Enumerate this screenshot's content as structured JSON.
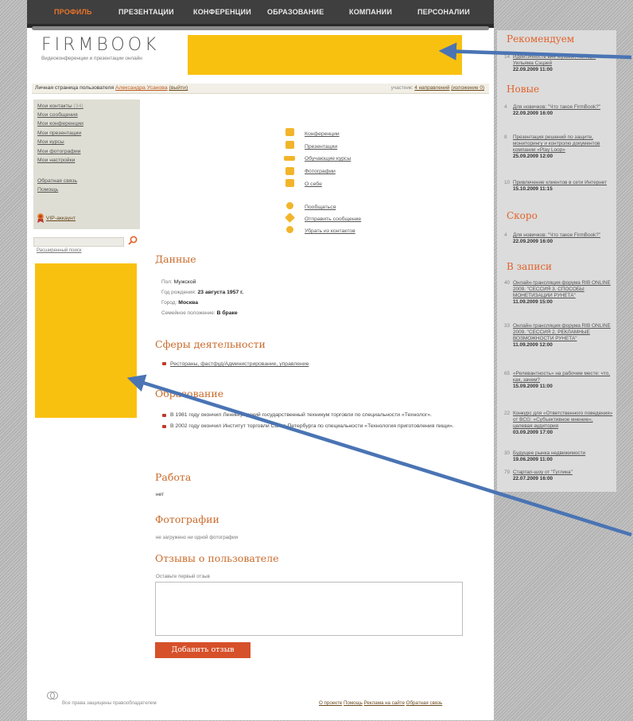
{
  "nav": {
    "items": [
      "ПРОФИЛЬ",
      "ПРЕЗЕНТАЦИИ",
      "КОНФЕРЕНЦИИ",
      "ОБРАЗОВАНИЕ",
      "КОМПАНИИ",
      "ПЕРСОНАЛИИ"
    ],
    "active_color": "#e8742a"
  },
  "logo": {
    "text": "FIRMBOOK",
    "tagline": "Видеоконференции и презентации онлайн"
  },
  "userbar": {
    "prefix": "Личная страница пользователя",
    "username": "Александра Усанова",
    "logout": "(выйти)",
    "participant": "участник:",
    "conf_link": "4 направлений",
    "resume_link": "(изложение 0)"
  },
  "sidebar": {
    "menu": [
      {
        "label": "Мои контакты",
        "count": "(34)"
      },
      {
        "label": "Мои сообщения",
        "count": ""
      },
      {
        "label": "Мои конференции",
        "count": ""
      },
      {
        "label": "Мои презентации",
        "count": ""
      },
      {
        "label": "Мои курсы",
        "count": ""
      },
      {
        "label": "Мои фотографии",
        "count": ""
      },
      {
        "label": "Мои настройки",
        "count": ""
      }
    ],
    "feedback": "Обратная связь",
    "help": "Помощь",
    "vip": "VIP-аккаунт",
    "extended_search": "Расширенный поиск"
  },
  "actions": {
    "links": [
      "Конференции",
      "Презентации",
      "Обучающие курсы",
      "Фотографии",
      "О себе"
    ],
    "contact_links": [
      "Пообщаться",
      "Отправить сообщение",
      "Убрать из контактов"
    ]
  },
  "data_section": {
    "title": "Данные",
    "rows": [
      {
        "label": "Пол:",
        "value": "Мужской"
      },
      {
        "label": "Год рождения:",
        "value": "23 августа 1957 г."
      },
      {
        "label": "Город:",
        "value": "Москва"
      },
      {
        "label": "Семейное положение:",
        "value": "В браке"
      }
    ]
  },
  "spheres": {
    "title": "Сферы деятельности",
    "item": "Рестораны, фастфуд/Администрирование, управление"
  },
  "education": {
    "title": "Образование",
    "items": [
      "В 1981 году окончил Ленинградский государственный техникум торговли по специальности «Технолог».",
      "В 2002 году окончил Институт торговли Санкт-Петербурга по специальности «Технология приготовления пищи»."
    ]
  },
  "work": {
    "title": "Работа",
    "value": "нет"
  },
  "photos": {
    "title": "Фотографии",
    "value": "не загружено ни одной фотографии"
  },
  "reviews": {
    "title": "Отзывы о пользователе",
    "hint": "Оставьте первый отзыв",
    "button": "Добавить отзыв"
  },
  "footer": {
    "copyright": "Все права защищены правообладателем",
    "links": [
      "О проекте",
      "Помощь",
      "Реклама на сайте",
      "Обратная связь"
    ]
  },
  "right": {
    "recommend": {
      "title": "Рекомендуем",
      "items": [
        {
          "num": "14",
          "text": "Идентичность вне музыки, паттерн Уильяма Сэцзей",
          "date": "22.09.2009 11:00"
        }
      ]
    },
    "new": {
      "title": "Новые",
      "items": [
        {
          "num": "4",
          "text": "Для новичков: \"Что такое FirmBook?\"",
          "date": "22.09.2009 16:00"
        },
        {
          "num": "8",
          "text": "Презентация решений по защите, мониторингу и контролю документов компании «Play Loop»",
          "date": "25.09.2009 12:00"
        },
        {
          "num": "10",
          "text": "Привлечение клиентов в сети Интернет",
          "date": "15.10.2009 11:15"
        }
      ]
    },
    "soon": {
      "title": "Скоро",
      "items": [
        {
          "num": "4",
          "text": "Для новичков: \"Что такое FirmBook?\"",
          "date": "22.09.2009 16:00"
        }
      ]
    },
    "recorded": {
      "title": "В записи",
      "items": [
        {
          "num": "40",
          "text": "Онлайн-трансляция форума RIB ONLINE 2009. \"СЕССИЯ 3. СПОСОБЫ МОНЕТИЗАЦИИ РУНЕТА\"",
          "date": "11.09.2009 15:00"
        },
        {
          "num": "33",
          "text": "Онлайн-трансляция форума RIB ONLINE 2009. \"СЕССИЯ 2. РЕКЛАМНЫЕ ВОЗМОЖНОСТИ РУНЕТА\"",
          "date": "11.09.2009 12:00"
        },
        {
          "num": "65",
          "text": "«Релевантность» на рабочем месте: что, как, зачем?",
          "date": "15.09.2009 11:00"
        },
        {
          "num": "22",
          "text": "Конкурс для «Ответственного поведения» от BCG: «Субъективное мнение», целевая аудитория",
          "date": "03.09.2009 17:00"
        },
        {
          "num": "30",
          "text": "Будущее рынка недвижимости",
          "date": "19.06.2009 11:00"
        },
        {
          "num": "79",
          "text": "Стартап-шоу от \"Гуглика\"",
          "date": "22.07.2009 16:00"
        }
      ]
    }
  },
  "arrow_color": "#4a74b4",
  "banner_color": "#f9c10f"
}
